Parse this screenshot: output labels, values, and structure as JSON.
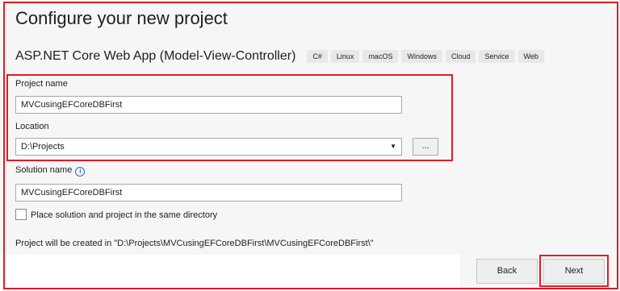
{
  "page": {
    "title": "Configure your new project"
  },
  "template": {
    "name": "ASP.NET Core Web App (Model-View-Controller)",
    "tags": [
      "C#",
      "Linux",
      "macOS",
      "Windows",
      "Cloud",
      "Service",
      "Web"
    ]
  },
  "form": {
    "project_name_label": "Project name",
    "project_name_value": "MVCusingEFCoreDBFirst",
    "location_label": "Location",
    "location_value": "D:\\Projects",
    "browse_label": "...",
    "solution_name_label": "Solution name",
    "solution_name_value": "MVCusingEFCoreDBFirst",
    "same_directory_label": "Place solution and project in the same directory",
    "same_directory_checked": false,
    "creation_path_text": "Project will be created in \"D:\\Projects\\MVCusingEFCoreDBFirst\\MVCusingEFCoreDBFirst\\\""
  },
  "footer": {
    "back_label": "Back",
    "next_label": "Next"
  },
  "colors": {
    "highlight": "#e31b23",
    "info_icon": "#1c6fd1"
  },
  "icons": {
    "info": "info-icon",
    "dropdown": "chevron-down-icon"
  }
}
